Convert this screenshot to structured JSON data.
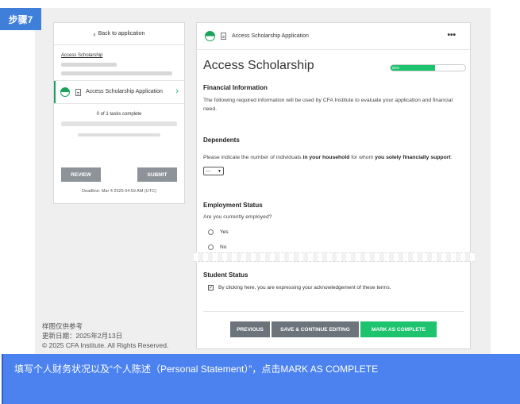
{
  "step_tag": "步骤7",
  "sidebar": {
    "back_label": "Back to application",
    "app_label": "Access Scholarship",
    "task_label": "Access Scholarship Application",
    "tasks_complete": "0 of 1 tasks complete",
    "review_label": "REVIEW",
    "submit_label": "SUBMIT",
    "deadline": "Deadline: Mar 4 2025 04:59 AM (UTC)"
  },
  "footer": {
    "line1": "样图仅供参考",
    "line2": "更新日期：2025年2月13日",
    "line3": "© 2025 CFA Institute. All Rights Reserved."
  },
  "main": {
    "header_title": "Access Scholarship Application",
    "page_title": "Access Scholarship",
    "progress_label": "60%",
    "progress_value": 0.6,
    "financial": {
      "heading": "Financial Information",
      "text": "The following required information will be used by CFA Institute to evaluate your application and financial need."
    },
    "dependents": {
      "heading": "Dependents",
      "text_a": "Please indicate the number of individuals ",
      "text_b": "in your household",
      "text_c": " for whom ",
      "text_d": "you solely financially support",
      "text_e": ":",
      "select_value": "---"
    },
    "employment": {
      "heading": "Employment Status",
      "question": "Are you currently employed?",
      "yes": "Yes",
      "no": "No"
    },
    "student": {
      "heading": "Student Status",
      "ack": "By clicking here, you are expressing your acknowledgement of these terms."
    },
    "buttons": {
      "previous": "PREVIOUS",
      "save": "SAVE & CONTINUE EDITING",
      "complete": "MARK AS COMPLETE"
    }
  },
  "caption": "填写个人财务状况以及“个人陈述（Personal Statement）”，点击MARK AS COMPLETE",
  "colors": {
    "accent_green": "#1ec36e",
    "caption_blue": "#4b82f0",
    "step_blue": "#3f7fd9"
  }
}
